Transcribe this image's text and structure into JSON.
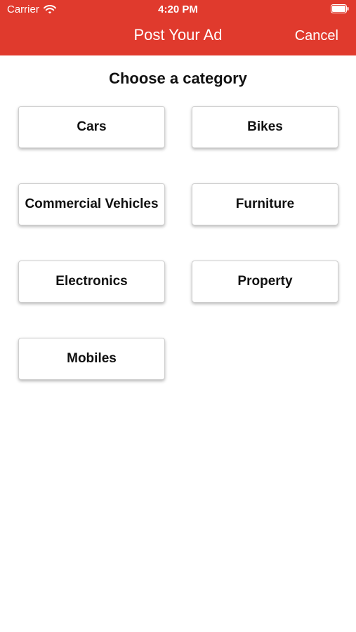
{
  "status_bar": {
    "carrier": "Carrier",
    "time": "4:20 PM",
    "wifi_icon": "wifi-icon",
    "battery_icon": "battery-icon"
  },
  "nav": {
    "title": "Post Your Ad",
    "cancel_label": "Cancel",
    "background_color": "#e03a2d"
  },
  "main": {
    "heading": "Choose a category",
    "categories": [
      "Cars",
      "Bikes",
      "Commercial Vehicles",
      "Furniture",
      "Electronics",
      "Property",
      "Mobiles"
    ]
  }
}
